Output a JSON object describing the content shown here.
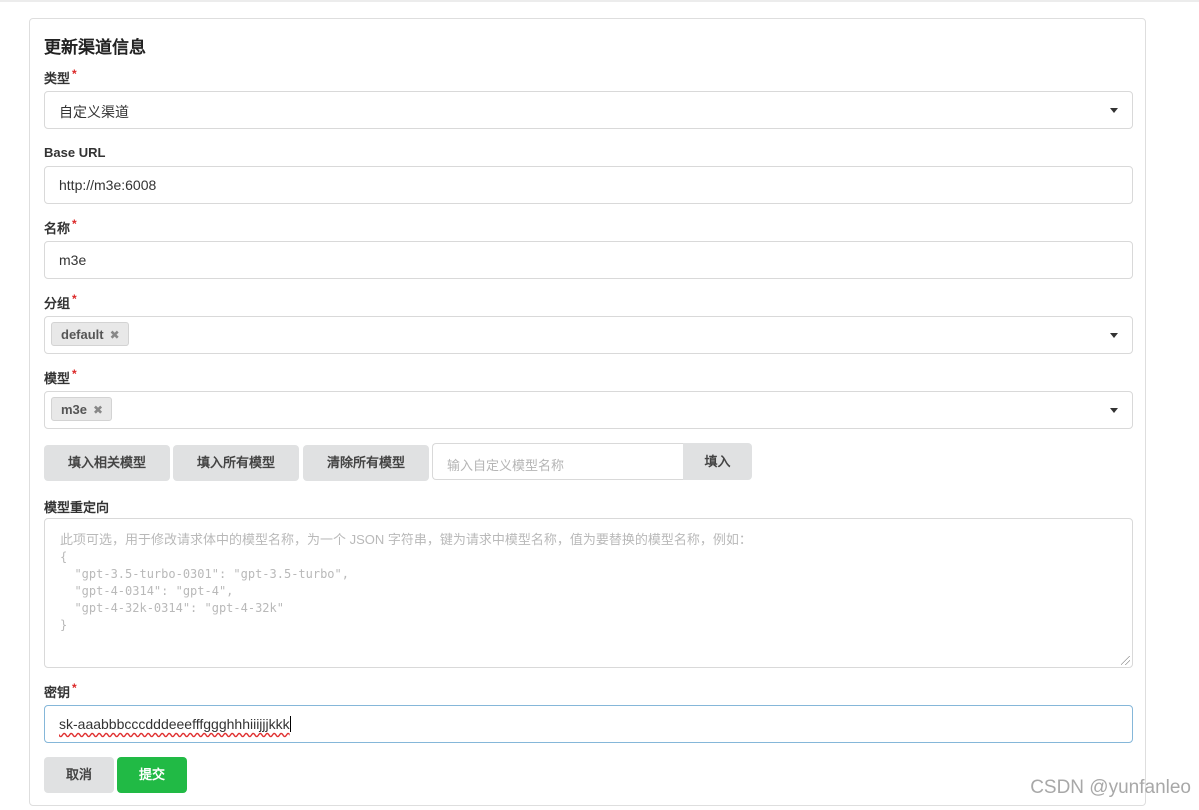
{
  "form": {
    "title": "更新渠道信息",
    "required_mark": "*",
    "type": {
      "label": "类型",
      "value": "自定义渠道"
    },
    "base_url": {
      "label": "Base URL",
      "value": "http://m3e:6008"
    },
    "name": {
      "label": "名称",
      "value": "m3e"
    },
    "group": {
      "label": "分组",
      "chips": [
        "default"
      ]
    },
    "models": {
      "label": "模型",
      "chips": [
        "m3e"
      ]
    },
    "model_buttons": {
      "fill_related": "填入相关模型",
      "fill_all": "填入所有模型",
      "clear_all": "清除所有模型",
      "custom_placeholder": "输入自定义模型名称",
      "fill": "填入"
    },
    "redirect": {
      "label": "模型重定向",
      "placeholder_lines": [
        "此项可选，用于修改请求体中的模型名称，为一个 JSON 字符串，键为请求中模型名称，值为要替换的模型名称，例如：",
        "{",
        "  \"gpt-3.5-turbo-0301\": \"gpt-3.5-turbo\",",
        "  \"gpt-4-0314\": \"gpt-4\",",
        "  \"gpt-4-32k-0314\": \"gpt-4-32k\"",
        "}"
      ]
    },
    "key": {
      "label": "密钥",
      "value": "sk-aaabbbcccdddeeefffggghhhiiijjjkkk"
    },
    "cancel": "取消",
    "submit": "提交"
  },
  "watermark": "CSDN @yunfanleo",
  "icons": {
    "dropdown": "caret-down-icon",
    "chip_remove": "close-icon"
  },
  "colors": {
    "submit": "#21ba45",
    "required": "#db2828",
    "focus_border": "#85b7d9"
  }
}
